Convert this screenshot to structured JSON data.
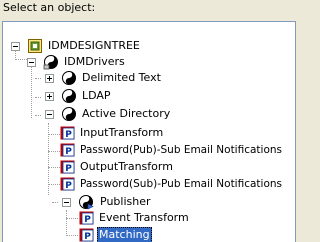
{
  "prompt": "Select an object:",
  "tree": {
    "root": "IDMDESIGNTREE",
    "drivers": "IDMDrivers",
    "delimited": "Delimited Text",
    "ldap": "LDAP",
    "ad": "Active Directory",
    "input_transform": "InputTransform",
    "pub_sub_email": "Password(Pub)-Sub Email Notifications",
    "output_transform": "OutputTransform",
    "sub_pub_email": "Password(Sub)-Pub Email Notifications",
    "publisher": "Publisher",
    "event_transform": "Event Transform",
    "matching": "Matching"
  },
  "colors": {
    "selection": "#316AC5",
    "policy_red": "#C00000",
    "policy_blue": "#003399"
  }
}
